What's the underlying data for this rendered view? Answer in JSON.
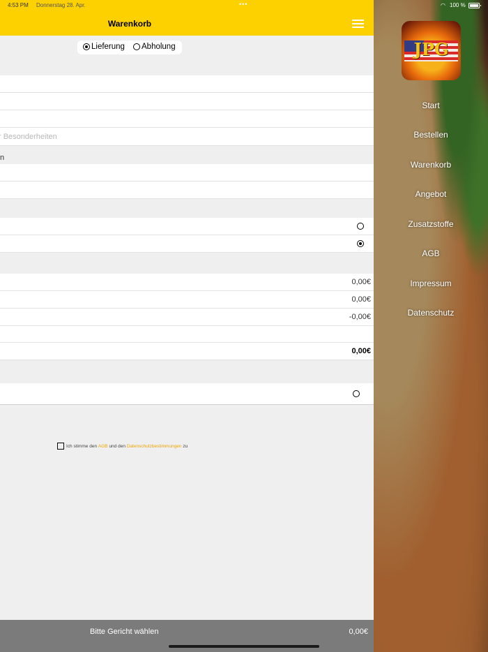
{
  "status": {
    "time": "4:53 PM",
    "date": "Donnerstag 28. Apr.",
    "battery": "100 %"
  },
  "header": {
    "title": "Warenkorb"
  },
  "delivery": {
    "options": [
      "Lieferung",
      "Abholung"
    ],
    "selected": "Lieferung"
  },
  "form": {
    "notes_placeholder": "r Besonderheiten",
    "section_label_fragment": "n"
  },
  "summary": {
    "amounts": [
      "0,00€",
      "0,00€",
      "-0,00€"
    ],
    "total": "0,00€"
  },
  "agreement": {
    "prefix": "Ich stimme den",
    "agb": "AGB",
    "middle": "und den",
    "privacy": "Datenschutzbestimmungen",
    "suffix": "zu"
  },
  "bottom_bar": {
    "label": "Bitte Gericht wählen",
    "price": "0,00€"
  },
  "menu": {
    "items": [
      "Start",
      "Bestellen",
      "Warenkorb",
      "Angebot",
      "Zusatzstoffe",
      "AGB",
      "Impressum",
      "Datenschutz"
    ]
  },
  "colors": {
    "accent": "#fdd000",
    "link": "#f0a500",
    "bottom_bar": "#7b7b7b"
  }
}
